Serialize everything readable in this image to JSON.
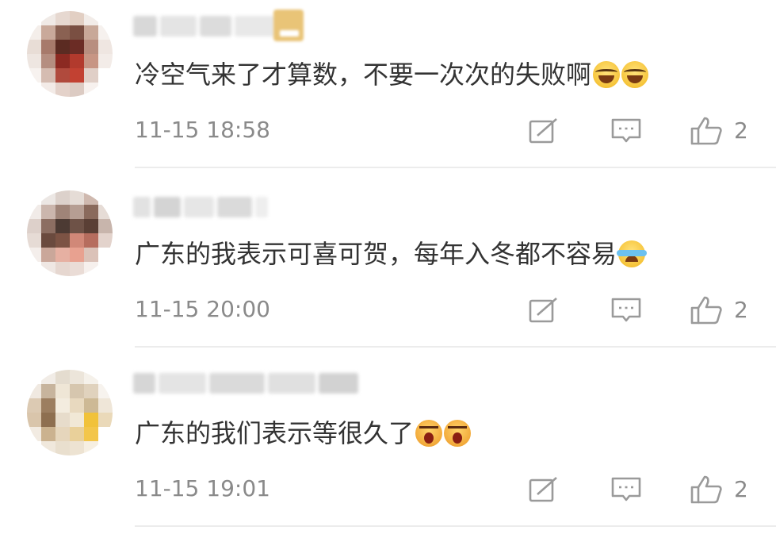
{
  "comments": [
    {
      "text": "冷空气来了才算数，不要一次次的失败啊",
      "emojis": [
        "laugh-tears-emoji",
        "laugh-tears-emoji"
      ],
      "time": "11-15 18:58",
      "likes": "2"
    },
    {
      "text": "广东的我表示可喜可贺，每年入冬都不容易",
      "emojis": [
        "crying-laughing-emoji"
      ],
      "time": "11-15 20:00",
      "likes": "2"
    },
    {
      "text": "广东的我们表示等很久了",
      "emojis": [
        "angry-face-emoji",
        "angry-face-emoji"
      ],
      "time": "11-15 19:01",
      "likes": "2"
    }
  ],
  "colors": {
    "text": "#333333",
    "meta": "#8a8a8a",
    "icon": "#9a9a9a",
    "divider": "#ececec"
  },
  "icons": [
    "repost-icon",
    "comment-icon",
    "like-icon"
  ]
}
